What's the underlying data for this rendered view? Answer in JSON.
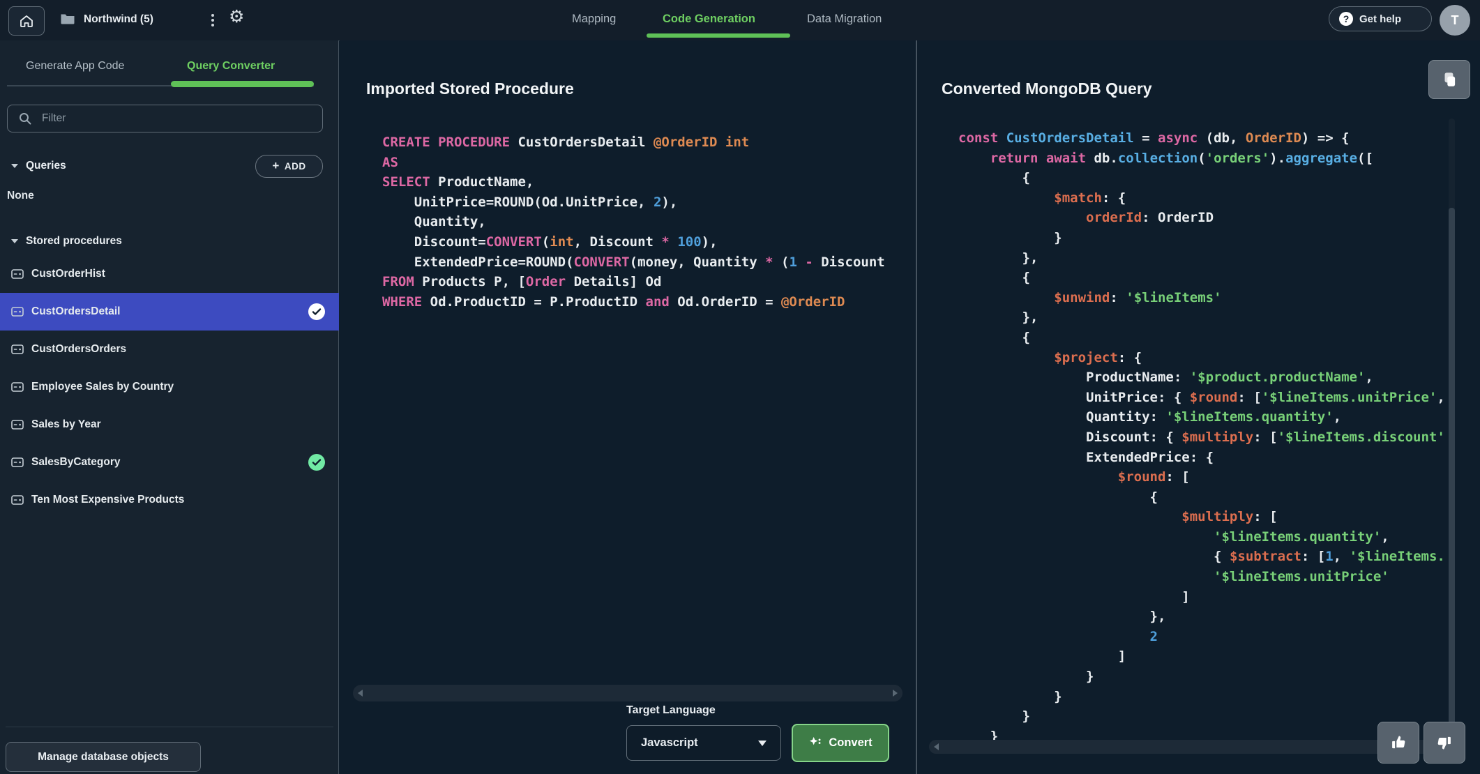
{
  "topbar": {
    "project": "Northwind (5)",
    "tabs": [
      {
        "label": "Mapping",
        "active": false
      },
      {
        "label": "Code Generation",
        "active": true
      },
      {
        "label": "Data Migration",
        "active": false
      }
    ],
    "get_help": "Get help",
    "avatar": "T"
  },
  "sidebar": {
    "tabs": [
      {
        "label": "Generate App Code",
        "active": false
      },
      {
        "label": "Query Converter",
        "active": true
      }
    ],
    "filter_placeholder": "Filter",
    "queries": {
      "label": "Queries",
      "add": "ADD",
      "empty": "None"
    },
    "stored": {
      "label": "Stored procedures",
      "items": [
        {
          "label": "CustOrderHist",
          "selected": false,
          "check": null
        },
        {
          "label": "CustOrdersDetail",
          "selected": true,
          "check": "white"
        },
        {
          "label": "CustOrdersOrders",
          "selected": false,
          "check": null
        },
        {
          "label": "Employee Sales by Country",
          "selected": false,
          "check": null
        },
        {
          "label": "Sales by Year",
          "selected": false,
          "check": null
        },
        {
          "label": "SalesByCategory",
          "selected": false,
          "check": "green"
        },
        {
          "label": "Ten Most Expensive Products",
          "selected": false,
          "check": null
        }
      ]
    },
    "manage": "Manage database objects"
  },
  "middle": {
    "title": "Imported Stored Procedure",
    "target_label": "Target Language",
    "language": "Javascript",
    "convert": "Convert",
    "code": [
      [
        [
          "k",
          "CREATE PROCEDURE "
        ],
        [
          "w",
          "CustOrdersDetail "
        ],
        [
          "o",
          "@OrderID int"
        ]
      ],
      [
        [
          "k",
          "AS"
        ]
      ],
      [
        [
          "k",
          "SELECT "
        ],
        [
          "w",
          "ProductName,"
        ]
      ],
      [
        [
          "w",
          "    UnitPrice=ROUND(Od.UnitPrice, "
        ],
        [
          "n",
          "2"
        ],
        [
          "w",
          "),"
        ]
      ],
      [
        [
          "w",
          "    Quantity,"
        ]
      ],
      [
        [
          "w",
          "    Discount="
        ],
        [
          "k",
          "CONVERT"
        ],
        [
          "w",
          "("
        ],
        [
          "o",
          "int"
        ],
        [
          "w",
          ", Discount "
        ],
        [
          "k",
          "*"
        ],
        [
          "w",
          " "
        ],
        [
          "n",
          "100"
        ],
        [
          "w",
          "),"
        ]
      ],
      [
        [
          "w",
          "    ExtendedPrice=ROUND("
        ],
        [
          "k",
          "CONVERT"
        ],
        [
          "w",
          "(money, Quantity "
        ],
        [
          "k",
          "*"
        ],
        [
          "w",
          " ("
        ],
        [
          "n",
          "1"
        ],
        [
          "w",
          " "
        ],
        [
          "k",
          "-"
        ],
        [
          "w",
          " Discount"
        ]
      ],
      [
        [
          "k",
          "FROM "
        ],
        [
          "w",
          "Products P, ["
        ],
        [
          "k",
          "Order"
        ],
        [
          "w",
          " Details] Od"
        ]
      ],
      [
        [
          "k",
          "WHERE "
        ],
        [
          "w",
          "Od.ProductID = P.ProductID "
        ],
        [
          "k",
          "and"
        ],
        [
          "w",
          " Od.OrderID = "
        ],
        [
          "o",
          "@OrderID"
        ]
      ]
    ]
  },
  "right": {
    "title": "Converted MongoDB Query",
    "code": [
      [
        [
          "k",
          "const "
        ],
        [
          "f",
          "CustOrdersDetail "
        ],
        [
          "w",
          "= "
        ],
        [
          "k",
          "async "
        ],
        [
          "w",
          "(db, "
        ],
        [
          "o",
          "OrderID"
        ],
        [
          "w",
          ") => {"
        ]
      ],
      [
        [
          "w",
          "    "
        ],
        [
          "k",
          "return await "
        ],
        [
          "w",
          "db."
        ],
        [
          "f",
          "collection"
        ],
        [
          "w",
          "("
        ],
        [
          "s",
          "'orders'"
        ],
        [
          "w",
          ")."
        ],
        [
          "f",
          "aggregate"
        ],
        [
          "w",
          "(["
        ]
      ],
      [
        [
          "w",
          "        {"
        ]
      ],
      [
        [
          "w",
          "            "
        ],
        [
          "d",
          "$match"
        ],
        [
          "w",
          ": {"
        ]
      ],
      [
        [
          "w",
          "                "
        ],
        [
          "d",
          "orderId"
        ],
        [
          "w",
          ": OrderID"
        ]
      ],
      [
        [
          "w",
          "            }"
        ]
      ],
      [
        [
          "w",
          "        },"
        ]
      ],
      [
        [
          "w",
          "        {"
        ]
      ],
      [
        [
          "w",
          "            "
        ],
        [
          "d",
          "$unwind"
        ],
        [
          "w",
          ": "
        ],
        [
          "s",
          "'$lineItems'"
        ]
      ],
      [
        [
          "w",
          "        },"
        ]
      ],
      [
        [
          "w",
          "        {"
        ]
      ],
      [
        [
          "w",
          "            "
        ],
        [
          "d",
          "$project"
        ],
        [
          "w",
          ": {"
        ]
      ],
      [
        [
          "w",
          "                ProductName: "
        ],
        [
          "s",
          "'$product.productName'"
        ],
        [
          "w",
          ","
        ]
      ],
      [
        [
          "w",
          "                UnitPrice: { "
        ],
        [
          "d",
          "$round"
        ],
        [
          "w",
          ": ["
        ],
        [
          "s",
          "'$lineItems.unitPrice'"
        ],
        [
          "w",
          ","
        ]
      ],
      [
        [
          "w",
          "                Quantity: "
        ],
        [
          "s",
          "'$lineItems.quantity'"
        ],
        [
          "w",
          ","
        ]
      ],
      [
        [
          "w",
          "                Discount: { "
        ],
        [
          "d",
          "$multiply"
        ],
        [
          "w",
          ": ["
        ],
        [
          "s",
          "'$lineItems.discount'"
        ]
      ],
      [
        [
          "w",
          "                ExtendedPrice: {"
        ]
      ],
      [
        [
          "w",
          "                    "
        ],
        [
          "d",
          "$round"
        ],
        [
          "w",
          ": ["
        ]
      ],
      [
        [
          "w",
          "                        {"
        ]
      ],
      [
        [
          "w",
          "                            "
        ],
        [
          "d",
          "$multiply"
        ],
        [
          "w",
          ": ["
        ]
      ],
      [
        [
          "w",
          "                                "
        ],
        [
          "s",
          "'$lineItems.quantity'"
        ],
        [
          "w",
          ","
        ]
      ],
      [
        [
          "w",
          "                                { "
        ],
        [
          "d",
          "$subtract"
        ],
        [
          "w",
          ": ["
        ],
        [
          "n",
          "1"
        ],
        [
          "w",
          ", "
        ],
        [
          "s",
          "'$lineItems."
        ]
      ],
      [
        [
          "w",
          "                                "
        ],
        [
          "s",
          "'$lineItems.unitPrice'"
        ]
      ],
      [
        [
          "w",
          "                            ]"
        ]
      ],
      [
        [
          "w",
          "                        },"
        ]
      ],
      [
        [
          "w",
          "                        "
        ],
        [
          "n",
          "2"
        ]
      ],
      [
        [
          "w",
          "                    ]"
        ]
      ],
      [
        [
          "w",
          "                }"
        ]
      ],
      [
        [
          "w",
          "            }"
        ]
      ],
      [
        [
          "w",
          "        }"
        ]
      ],
      [
        [
          "w",
          "    }"
        ]
      ]
    ]
  },
  "colors": {
    "accent_green": "#6fd062",
    "selected_blue": "#3d4bc0",
    "check_green": "#71e9a4",
    "convert_green": "#3e7d47",
    "code_keyword_pink": "#dd68a4",
    "code_orange": "#de8a52",
    "code_string_green": "#78d078",
    "code_number_blue": "#4f9fdb"
  }
}
